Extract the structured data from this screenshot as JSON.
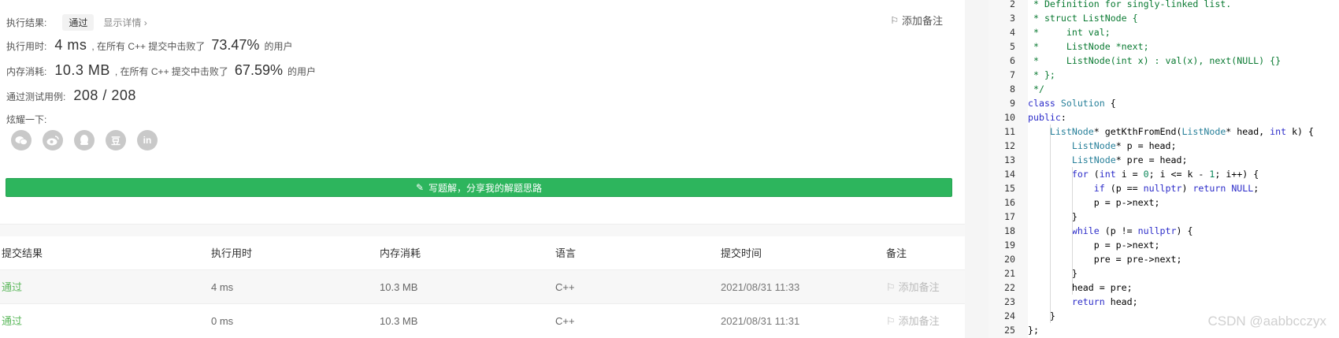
{
  "result": {
    "label": "执行结果:",
    "status": "通过",
    "details": "显示详情 ›",
    "add_note": "添加备注"
  },
  "runtime": {
    "label": "执行用时:",
    "value": "4 ms",
    "prefix": ", 在所有 C++ 提交中击败了",
    "percent": "73.47%",
    "suffix": "的用户"
  },
  "memory": {
    "label": "内存消耗:",
    "value": "10.3 MB",
    "prefix": ", 在所有 C++ 提交中击败了",
    "percent": "67.59%",
    "suffix": "的用户"
  },
  "tests": {
    "label": "通过测试用例:",
    "value": "208 / 208"
  },
  "share": {
    "label": "炫耀一下:",
    "icons": [
      "wechat-icon",
      "weibo-icon",
      "qq-icon",
      "douban-icon",
      "linkedin-icon"
    ],
    "glyphs": [
      "",
      "",
      "",
      "豆",
      "in"
    ]
  },
  "solution_button": "写题解，分享我的解题思路",
  "table": {
    "headers": [
      "提交结果",
      "执行用时",
      "内存消耗",
      "语言",
      "提交时间",
      "备注"
    ],
    "rows": [
      {
        "result": "通过",
        "time": "4 ms",
        "memory": "10.3 MB",
        "lang": "C++",
        "submitted": "2021/08/31 11:33",
        "note": "添加备注"
      },
      {
        "result": "通过",
        "time": "0 ms",
        "memory": "10.3 MB",
        "lang": "C++",
        "submitted": "2021/08/31 11:31",
        "note": "添加备注"
      }
    ]
  },
  "code": {
    "line_numbers": [
      "2",
      "3",
      "4",
      "5",
      "6",
      "7",
      "8",
      "9",
      "10",
      "11",
      "12",
      "13",
      "14",
      "15",
      "16",
      "17",
      "18",
      "19",
      "20",
      "21",
      "22",
      "23",
      "24",
      "25"
    ],
    "lines": [
      " * Definition for singly-linked list.",
      " * struct ListNode {",
      " *     int val;",
      " *     ListNode *next;",
      " *     ListNode(int x) : val(x), next(NULL) {}",
      " * };",
      " */",
      "class Solution {",
      "public:",
      "    ListNode* getKthFromEnd(ListNode* head, int k) {",
      "        ListNode* p = head;",
      "        ListNode* pre = head;",
      "        for (int i = 0; i <= k - 1; i++) {",
      "            if (p == nullptr) return NULL;",
      "            p = p->next;",
      "        }",
      "        while (p != nullptr) {",
      "            p = p->next;",
      "            pre = pre->next;",
      "        }",
      "        head = pre;",
      "        return head;",
      "    }",
      "};"
    ]
  },
  "watermark": "CSDN @aabbcczyx",
  "colors": {
    "accent_green": "#2db55d",
    "pass_green": "#5cb85c",
    "keyword_blue": "#2c2cc9",
    "comment_green": "#0a7a32"
  }
}
